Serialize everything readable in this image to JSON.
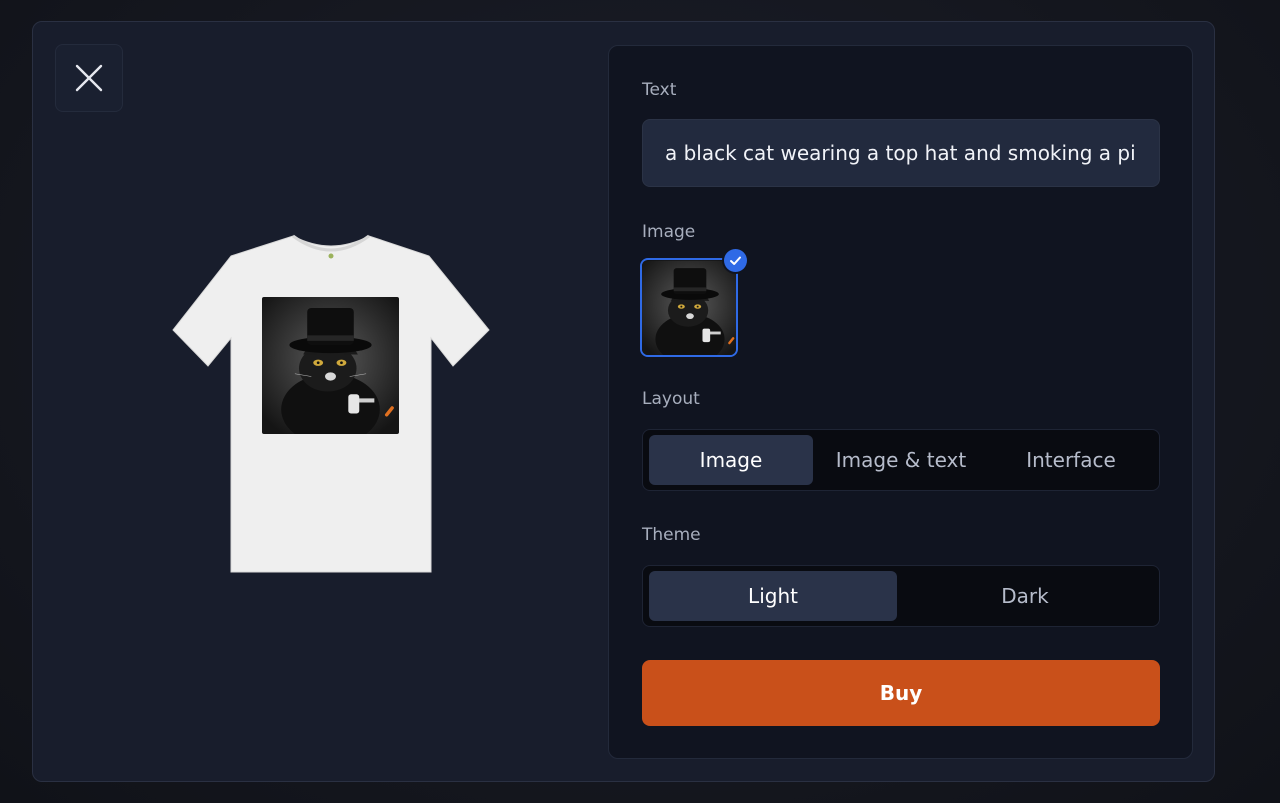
{
  "close": {
    "icon": "close-icon"
  },
  "preview": {
    "icon": "tshirt-preview"
  },
  "form": {
    "text_label": "Text",
    "text_value": "a black cat wearing a top hat and smoking a pi",
    "image_label": "Image",
    "selected_badge_icon": "check-icon",
    "layout_label": "Layout",
    "layout_options": [
      "Image",
      "Image & text",
      "Interface"
    ],
    "layout_selected": "Image",
    "theme_label": "Theme",
    "theme_options": [
      "Light",
      "Dark"
    ],
    "theme_selected": "Light",
    "buy_label": "Buy"
  },
  "colors": {
    "accent": "#c9501a",
    "selection": "#2f6ae6",
    "active_segment": "#2a3349"
  }
}
